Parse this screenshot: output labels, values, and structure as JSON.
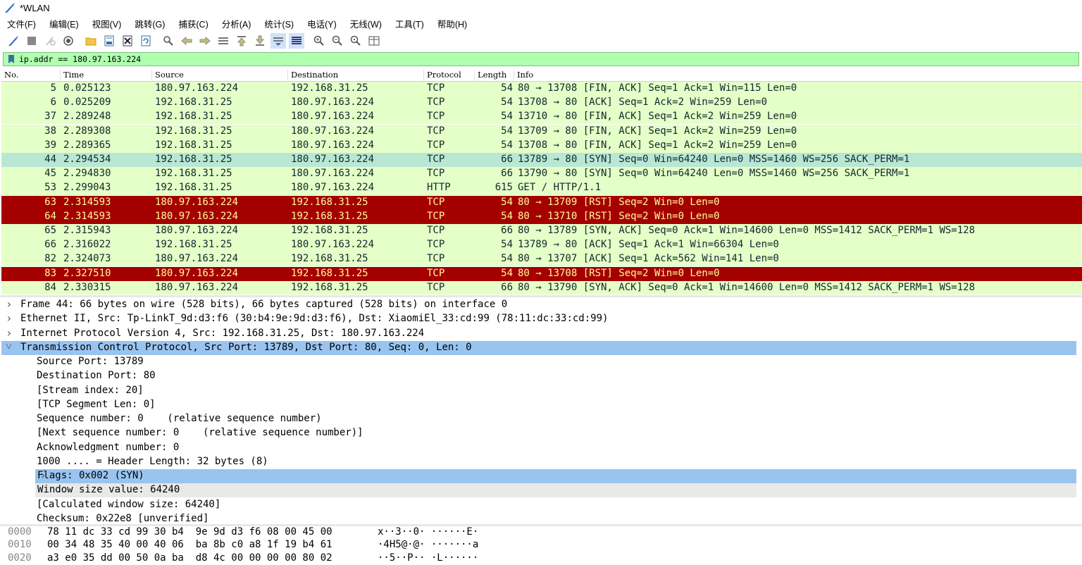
{
  "window": {
    "title": "*WLAN"
  },
  "menu": [
    "文件(F)",
    "编辑(E)",
    "视图(V)",
    "跳转(G)",
    "捕获(C)",
    "分析(A)",
    "统计(S)",
    "电话(Y)",
    "无线(W)",
    "工具(T)",
    "帮助(H)"
  ],
  "toolbar_icons": [
    "shark-fin-start-icon",
    "stop-icon",
    "restart-icon",
    "options-gear-icon",
    "open-folder-icon",
    "save-file-icon",
    "close-file-icon",
    "reload-file-icon",
    "find-packet-icon",
    "go-back-icon",
    "go-forward-icon",
    "go-to-packet-icon",
    "go-first-icon",
    "go-last-icon",
    "autoscroll-icon",
    "colorize-icon",
    "zoom-in-icon",
    "zoom-out-icon",
    "zoom-normal-icon",
    "resize-columns-icon"
  ],
  "filter": {
    "value": "ip.addr == 180.97.163.224",
    "background": "#afffaf"
  },
  "packet_list": {
    "columns": [
      "No.",
      "Time",
      "Source",
      "Destination",
      "Protocol",
      "Length",
      "Info"
    ],
    "rows": [
      {
        "no": "5",
        "time": "0.025123",
        "src": "180.97.163.224",
        "dst": "192.168.31.25",
        "proto": "TCP",
        "len": "54",
        "info": "80 → 13708 [FIN, ACK] Seq=1 Ack=1 Win=115 Len=0",
        "style": "green"
      },
      {
        "no": "6",
        "time": "0.025209",
        "src": "192.168.31.25",
        "dst": "180.97.163.224",
        "proto": "TCP",
        "len": "54",
        "info": "13708 → 80 [ACK] Seq=1 Ack=2 Win=259 Len=0",
        "style": "green"
      },
      {
        "no": "37",
        "time": "2.289248",
        "src": "192.168.31.25",
        "dst": "180.97.163.224",
        "proto": "TCP",
        "len": "54",
        "info": "13710 → 80 [FIN, ACK] Seq=1 Ack=2 Win=259 Len=0",
        "style": "green"
      },
      {
        "no": "38",
        "time": "2.289308",
        "src": "192.168.31.25",
        "dst": "180.97.163.224",
        "proto": "TCP",
        "len": "54",
        "info": "13709 → 80 [FIN, ACK] Seq=1 Ack=2 Win=259 Len=0",
        "style": "green"
      },
      {
        "no": "39",
        "time": "2.289365",
        "src": "192.168.31.25",
        "dst": "180.97.163.224",
        "proto": "TCP",
        "len": "54",
        "info": "13708 → 80 [FIN, ACK] Seq=1 Ack=2 Win=259 Len=0",
        "style": "green"
      },
      {
        "no": "44",
        "time": "2.294534",
        "src": "192.168.31.25",
        "dst": "180.97.163.224",
        "proto": "TCP",
        "len": "66",
        "info": "13789 → 80 [SYN] Seq=0 Win=64240 Len=0 MSS=1460 WS=256 SACK_PERM=1",
        "style": "sel"
      },
      {
        "no": "45",
        "time": "2.294830",
        "src": "192.168.31.25",
        "dst": "180.97.163.224",
        "proto": "TCP",
        "len": "66",
        "info": "13790 → 80 [SYN] Seq=0 Win=64240 Len=0 MSS=1460 WS=256 SACK_PERM=1",
        "style": "green"
      },
      {
        "no": "53",
        "time": "2.299043",
        "src": "192.168.31.25",
        "dst": "180.97.163.224",
        "proto": "HTTP",
        "len": "615",
        "info": "GET / HTTP/1.1",
        "style": "green"
      },
      {
        "no": "63",
        "time": "2.314593",
        "src": "180.97.163.224",
        "dst": "192.168.31.25",
        "proto": "TCP",
        "len": "54",
        "info": "80 → 13709 [RST] Seq=2 Win=0 Len=0",
        "style": "red"
      },
      {
        "no": "64",
        "time": "2.314593",
        "src": "180.97.163.224",
        "dst": "192.168.31.25",
        "proto": "TCP",
        "len": "54",
        "info": "80 → 13710 [RST] Seq=2 Win=0 Len=0",
        "style": "red"
      },
      {
        "no": "65",
        "time": "2.315943",
        "src": "180.97.163.224",
        "dst": "192.168.31.25",
        "proto": "TCP",
        "len": "66",
        "info": "80 → 13789 [SYN, ACK] Seq=0 Ack=1 Win=14600 Len=0 MSS=1412 SACK_PERM=1 WS=128",
        "style": "green"
      },
      {
        "no": "66",
        "time": "2.316022",
        "src": "192.168.31.25",
        "dst": "180.97.163.224",
        "proto": "TCP",
        "len": "54",
        "info": "13789 → 80 [ACK] Seq=1 Ack=1 Win=66304 Len=0",
        "style": "green"
      },
      {
        "no": "82",
        "time": "2.324073",
        "src": "180.97.163.224",
        "dst": "192.168.31.25",
        "proto": "TCP",
        "len": "54",
        "info": "80 → 13707 [ACK] Seq=1 Ack=562 Win=141 Len=0",
        "style": "green"
      },
      {
        "no": "83",
        "time": "2.327510",
        "src": "180.97.163.224",
        "dst": "192.168.31.25",
        "proto": "TCP",
        "len": "54",
        "info": "80 → 13708 [RST] Seq=2 Win=0 Len=0",
        "style": "red"
      },
      {
        "no": "84",
        "time": "2.330315",
        "src": "180.97.163.224",
        "dst": "192.168.31.25",
        "proto": "TCP",
        "len": "66",
        "info": "80 → 13790 [SYN, ACK] Seq=0 Ack=1 Win=14600 Len=0 MSS=1412 SACK_PERM=1 WS=128",
        "style": "green"
      }
    ]
  },
  "details": [
    {
      "text": "Frame 44: 66 bytes on wire (528 bits), 66 bytes captured (528 bits) on interface 0",
      "indent": 0,
      "expander": "collapsed",
      "style": ""
    },
    {
      "text": "Ethernet II, Src: Tp-LinkT_9d:d3:f6 (30:b4:9e:9d:d3:f6), Dst: XiaomiEl_33:cd:99 (78:11:dc:33:cd:99)",
      "indent": 0,
      "expander": "collapsed",
      "style": ""
    },
    {
      "text": "Internet Protocol Version 4, Src: 192.168.31.25, Dst: 180.97.163.224",
      "indent": 0,
      "expander": "collapsed",
      "style": ""
    },
    {
      "text": "Transmission Control Protocol, Src Port: 13789, Dst Port: 80, Seq: 0, Len: 0",
      "indent": 0,
      "expander": "expanded",
      "style": "dsel"
    },
    {
      "text": "Source Port: 13789",
      "indent": 1,
      "expander": "",
      "style": ""
    },
    {
      "text": "Destination Port: 80",
      "indent": 1,
      "expander": "",
      "style": ""
    },
    {
      "text": "[Stream index: 20]",
      "indent": 1,
      "expander": "",
      "style": ""
    },
    {
      "text": "[TCP Segment Len: 0]",
      "indent": 1,
      "expander": "",
      "style": ""
    },
    {
      "text": "Sequence number: 0    (relative sequence number)",
      "indent": 1,
      "expander": "",
      "style": ""
    },
    {
      "text": "[Next sequence number: 0    (relative sequence number)]",
      "indent": 1,
      "expander": "",
      "style": ""
    },
    {
      "text": "Acknowledgment number: 0",
      "indent": 1,
      "expander": "",
      "style": ""
    },
    {
      "text": "1000 .... = Header Length: 32 bytes (8)",
      "indent": 1,
      "expander": "",
      "style": ""
    },
    {
      "text": "Flags: 0x002 (SYN)",
      "indent": 1,
      "expander": "collapsed",
      "style": "dsel"
    },
    {
      "text": "Window size value: 64240",
      "indent": 1,
      "expander": "",
      "style": "dgray"
    },
    {
      "text": "[Calculated window size: 64240]",
      "indent": 1,
      "expander": "",
      "style": ""
    },
    {
      "text": "Checksum: 0x22e8 [unverified]",
      "indent": 1,
      "expander": "",
      "style": ""
    }
  ],
  "bytes": [
    {
      "offset": "0000",
      "hex": "78 11 dc 33 cd 99 30 b4  9e 9d d3 f6 08 00 45 00",
      "ascii": "x··3··0· ······E·"
    },
    {
      "offset": "0010",
      "hex": "00 34 48 35 40 00 40 06  ba 8b c0 a8 1f 19 b4 61",
      "ascii": "·4H5@·@· ·······a"
    },
    {
      "offset": "0020",
      "hex": "a3 e0 35 dd 00 50 0a ba  d8 4c 00 00 00 00 80 02",
      "ascii": "··5··P·· ·L······"
    }
  ],
  "colors": {
    "accent": "#2f6bd8",
    "row_green": "#e4ffc7",
    "row_selected": "#b8e7d4",
    "row_red": "#a40000",
    "row_red_text": "#fffc9c",
    "detail_selected": "#99c4f0"
  }
}
